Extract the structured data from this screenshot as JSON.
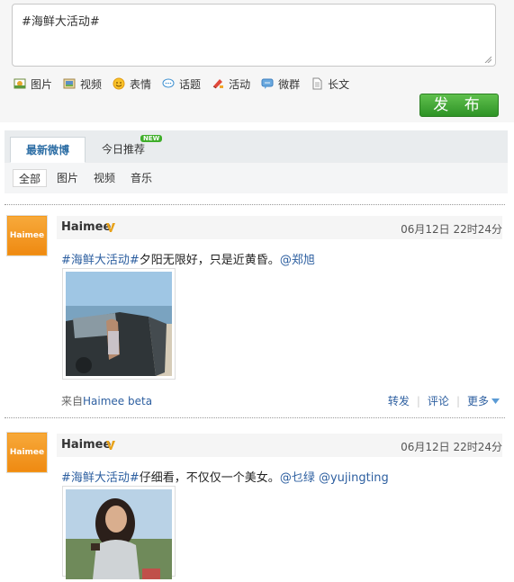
{
  "composer": {
    "text": "#海鲜大活动#",
    "tools": [
      {
        "label": "图片",
        "icon": "image-icon"
      },
      {
        "label": "视频",
        "icon": "video-icon"
      },
      {
        "label": "表情",
        "icon": "emoji-icon"
      },
      {
        "label": "话题",
        "icon": "topic-icon"
      },
      {
        "label": "活动",
        "icon": "event-icon"
      },
      {
        "label": "微群",
        "icon": "group-icon"
      },
      {
        "label": "长文",
        "icon": "document-icon"
      }
    ],
    "publish_label": "发 布"
  },
  "tabs": {
    "active": "最新微博",
    "second": "今日推荐",
    "new_badge": "NEW"
  },
  "filters": [
    "全部",
    "图片",
    "视频",
    "音乐"
  ],
  "posts": [
    {
      "avatar_text": "Haimee",
      "user": "Haimee",
      "time": "06月12日 22时24分",
      "topic": "#海鲜大活动#",
      "text": "夕阳无限好，只是近黄昏。",
      "mention": "@郑旭",
      "source_prefix": "来自",
      "source": "Haimee beta",
      "actions": {
        "repost": "转发",
        "comment": "评论",
        "more": "更多"
      }
    },
    {
      "avatar_text": "Haimee",
      "user": "Haimee",
      "time": "06月12日 22时24分",
      "topic": "#海鲜大活动#",
      "text": "仔细看，不仅仅一个美女。",
      "mention": "@乜绿 @yujingting"
    }
  ],
  "colors": {
    "accent": "#2d5fa0",
    "publish": "#3aa52e",
    "avatar": "#f59a1b"
  }
}
